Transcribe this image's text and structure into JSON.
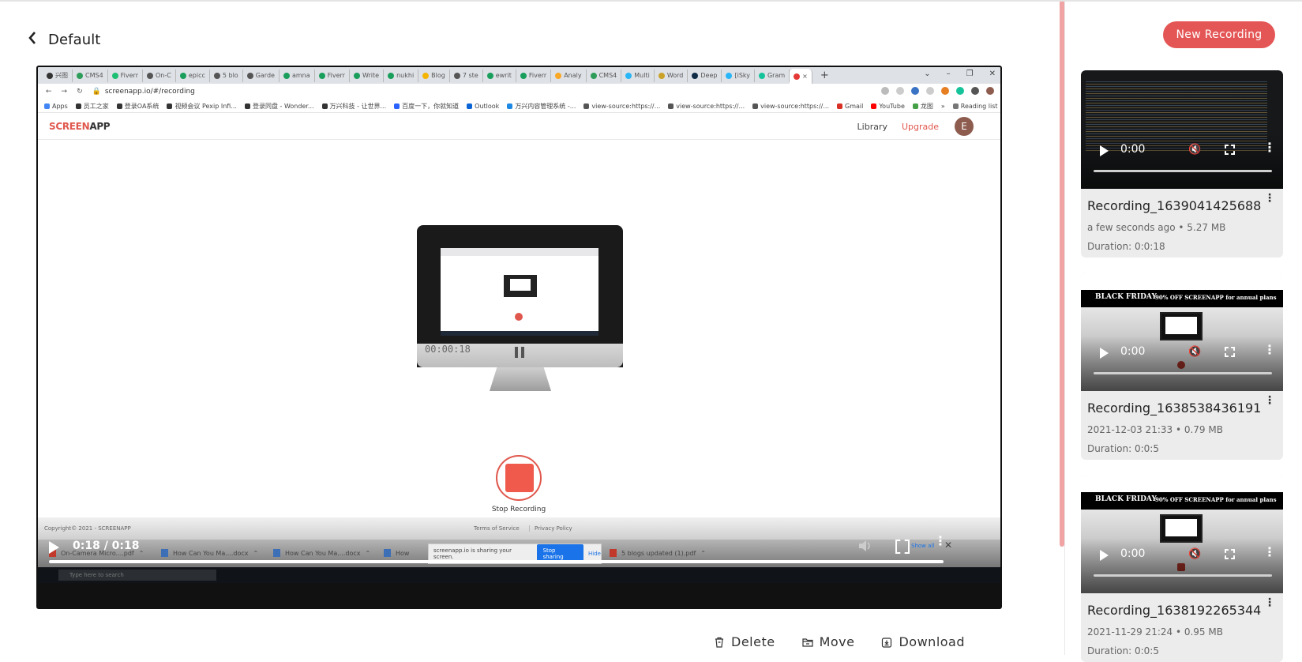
{
  "header": {
    "title": "Default"
  },
  "sidebar": {
    "new_recording_label": "New Recording",
    "recordings": [
      {
        "title": "Recording_1639041425688",
        "meta": "a few seconds ago • 5.27 MB",
        "duration": "Duration: 0:0:18",
        "player_time": "0:00"
      },
      {
        "title": "Recording_1638538436191",
        "meta": "2021-12-03 21:33 • 0.79 MB",
        "duration": "Duration: 0:0:5",
        "player_time": "0:00"
      },
      {
        "title": "Recording_1638192265344",
        "meta": "2021-11-29 21:24 • 0.95 MB",
        "duration": "Duration: 0:0:5",
        "player_time": "0:00"
      }
    ],
    "thumb_banner": {
      "left": "BLACK FRIDAY",
      "right": "90% OFF SCREENAPP for annual plans"
    }
  },
  "player": {
    "time": "0:18 / 0:18",
    "progress": 1.0,
    "show_all": "Show all",
    "browser": {
      "tabs": [
        "兴图",
        "CMS4",
        "Fiverr",
        "On-C",
        "epicc",
        "5 blo",
        "Garde",
        "amna",
        "Fiverr",
        "Write",
        "nukhi",
        "Blog",
        "7 ste",
        "ewrit",
        "Fiverr",
        "Analy",
        "CMS4",
        "Multi",
        "Word",
        "Deep",
        "[iSky",
        "Gram"
      ],
      "url": "screenapp.io/#/recording",
      "bookmarks": [
        "Apps",
        "员工之家",
        "登录OA系统",
        "视频会议 Pexip Infi...",
        "登录同盘 - Wonder...",
        "万兴科技 - 让世界...",
        "百度一下，你就知道",
        "Outlook",
        "万兴内容管理系统 -...",
        "view-source:https://...",
        "view-source:https://...",
        "view-source:https://...",
        "Gmail",
        "YouTube",
        "龙图",
        "»",
        "Reading list"
      ]
    },
    "app": {
      "logo_red": "SCREEN",
      "logo_dark": "APP",
      "nav_library": "Library",
      "nav_upgrade": "Upgrade",
      "avatar_letter": "E",
      "recording_timer": "00:00:18",
      "stop_label": "Stop Recording",
      "footer_copyright": "Copyright©  2021 - SCREENAPP",
      "footer_terms": "Terms of Service",
      "footer_privacy": "Privacy Policy"
    },
    "downloads": [
      {
        "name": "On-Camera Micro....pdf"
      },
      {
        "name": "How Can You Ma....docx"
      },
      {
        "name": "How Can You Ma....docx"
      },
      {
        "name": "How"
      },
      {
        "name": "5 blogs updated (1).pdf"
      }
    ],
    "share_notice": {
      "text": "screenapp.io is sharing your screen.",
      "stop": "Stop sharing",
      "hide": "Hide"
    },
    "taskbar_search": "Type here to search"
  },
  "actions": {
    "delete": "Delete",
    "move": "Move",
    "download": "Download"
  },
  "colors": {
    "accent": "#e45655",
    "sidebar_bar": "#f0a4a4"
  }
}
